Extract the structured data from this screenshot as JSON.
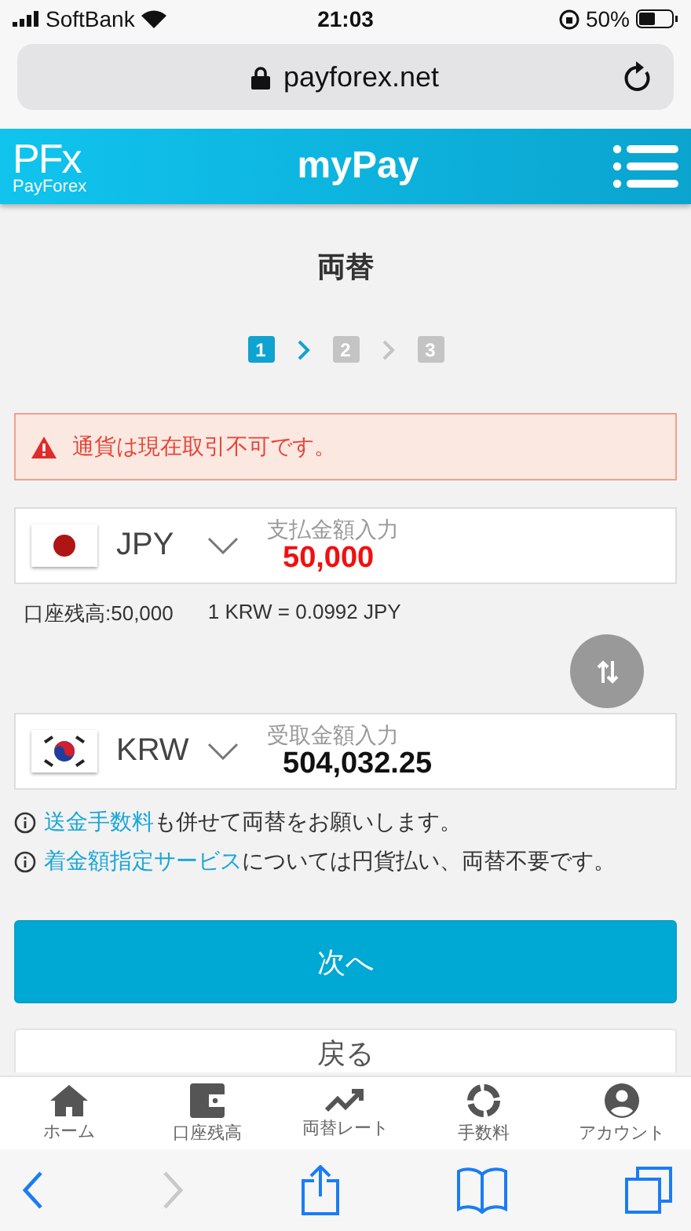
{
  "status_bar": {
    "carrier": "SoftBank",
    "time": "21:03",
    "battery": "50%"
  },
  "browser": {
    "url": "payforex.net"
  },
  "header": {
    "logo_mark": "PFx",
    "logo_text": "PayForex",
    "title": "myPay"
  },
  "page_title": "両替",
  "steps": [
    {
      "label": "1",
      "selected": true
    },
    {
      "label": "2",
      "selected": false
    },
    {
      "label": "3",
      "selected": false
    }
  ],
  "alert": {
    "text": "通貨は現在取引不可です。"
  },
  "pay": {
    "kind": "japan",
    "currency": "JPY",
    "label": "支払金額入力",
    "amount": "50,000",
    "error": true
  },
  "balance": "口座残高:50,000",
  "rate": "1 KRW = 0.0992 JPY",
  "receive": {
    "kind": "korea",
    "currency": "KRW",
    "label": "受取金額入力",
    "amount": "504,032.25",
    "error": false
  },
  "notes": [
    {
      "link": "送金手数料",
      "text": "も併せて両替をお願いします。"
    },
    {
      "link": "着金額指定サービス",
      "text": "については円貨払い、両替不要です。"
    }
  ],
  "next_button": "次へ",
  "back_button": "戻る",
  "tab_bar": [
    {
      "kind": "home",
      "label": "ホーム"
    },
    {
      "kind": "wallet",
      "label": "口座残高"
    },
    {
      "kind": "trend",
      "label": "両替レート"
    },
    {
      "kind": "ring",
      "label": "手数料"
    },
    {
      "kind": "account",
      "label": "アカウント"
    }
  ],
  "toolbar": [
    {
      "kind": "back",
      "disabled": false
    },
    {
      "kind": "forward",
      "disabled": true
    },
    {
      "kind": "share",
      "disabled": false
    },
    {
      "kind": "bookmarks",
      "disabled": false
    },
    {
      "kind": "tabs",
      "disabled": false
    }
  ]
}
